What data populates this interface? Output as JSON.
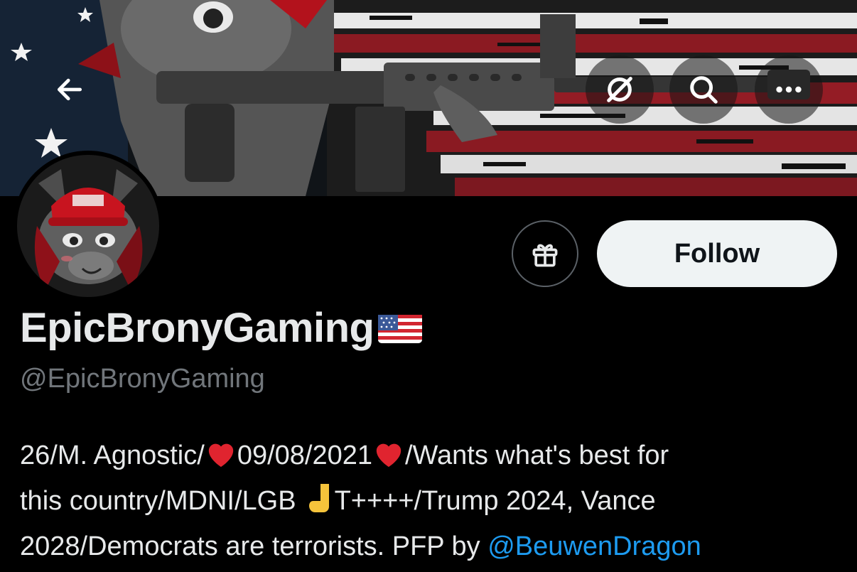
{
  "header": {
    "back_icon": "arrow-left-icon",
    "grok_icon": "grok-icon",
    "search_icon": "search-icon",
    "more_icon": "more-horizontal-icon"
  },
  "actions": {
    "gift_icon": "gift-icon",
    "follow_label": "Follow"
  },
  "profile": {
    "display_name": "EpicBronyGaming",
    "name_emoji": "us-flag",
    "handle": "@EpicBronyGaming",
    "bio": {
      "line1_a": "26/M. Agnostic/",
      "line1_b": "09/08/2021",
      "line1_c": "/Wants what's best for",
      "line2_a": "this country/MDNI/LGB",
      "line2_b": "T++++/Trump 2024, Vance",
      "line3_a": "2028/Democrats are terrorists. PFP by ",
      "line3_mention": "@BeuwenDragon"
    }
  },
  "colors": {
    "background": "#000000",
    "text_primary": "#e7e9ea",
    "text_secondary": "#71767b",
    "link": "#1d9bf0",
    "follow_bg": "#eff3f4",
    "follow_text": "#0f1419",
    "border": "#5b6167"
  }
}
